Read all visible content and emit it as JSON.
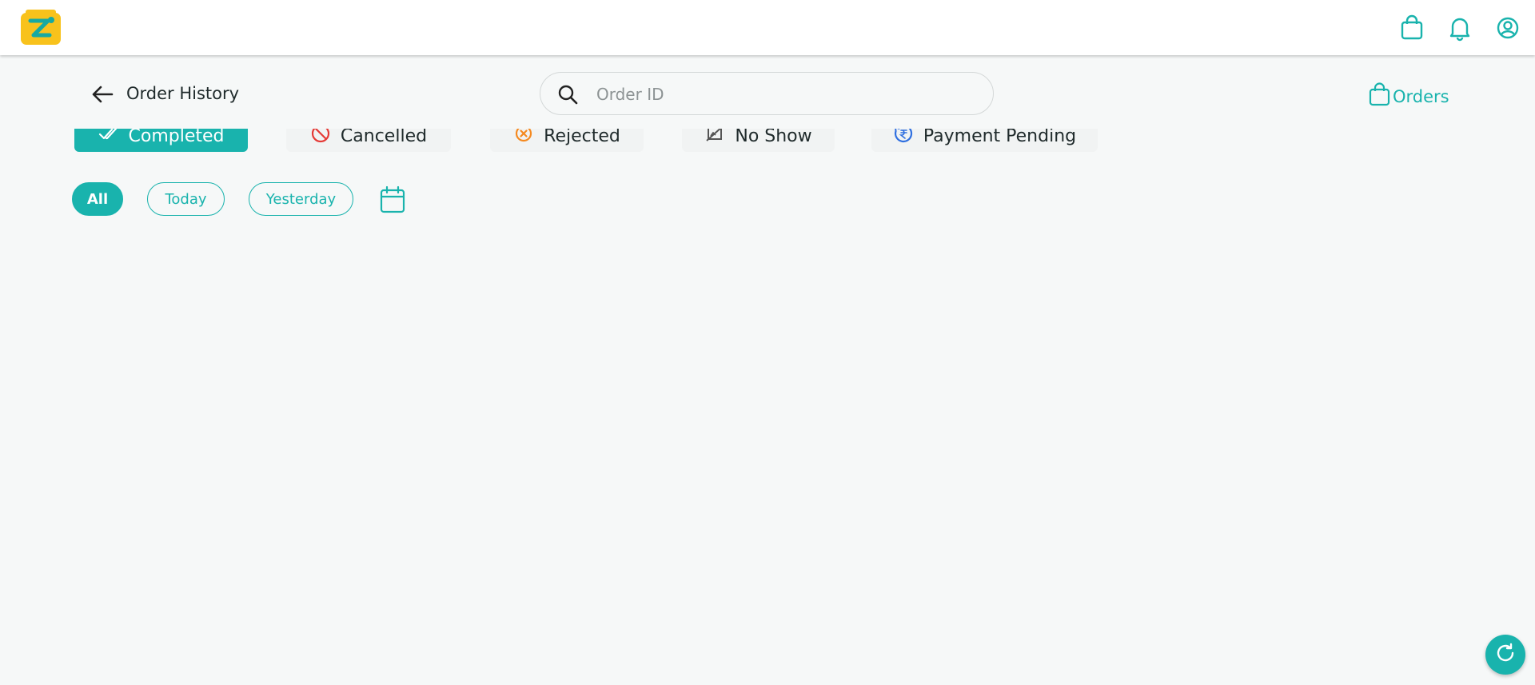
{
  "header": {
    "icons": [
      "app-logo",
      "shopping-bag-icon",
      "bell-icon",
      "user-circle-icon"
    ]
  },
  "subheader": {
    "title": "Order History",
    "search_placeholder": "Order ID",
    "search_value": "",
    "orders_label": "Orders"
  },
  "status_tabs": [
    {
      "label": "Completed",
      "icon": "double-check-icon",
      "active": true
    },
    {
      "label": "Cancelled",
      "icon": "ban-icon",
      "active": false
    },
    {
      "label": "Rejected",
      "icon": "x-circle-icon",
      "active": false
    },
    {
      "label": "No Show",
      "icon": "no-show-icon",
      "active": false
    },
    {
      "label": "Payment Pending",
      "icon": "rupee-pending-icon",
      "active": false
    }
  ],
  "date_filters": [
    {
      "label": "All",
      "active": true
    },
    {
      "label": "Today",
      "active": false
    },
    {
      "label": "Yesterday",
      "active": false
    }
  ],
  "colors": {
    "accent": "#19b3ad",
    "logo_yellow": "#f8c21c",
    "cancel_red": "#e53935",
    "reject_orange": "#f5891f",
    "pending_blue": "#2f6fe0"
  }
}
